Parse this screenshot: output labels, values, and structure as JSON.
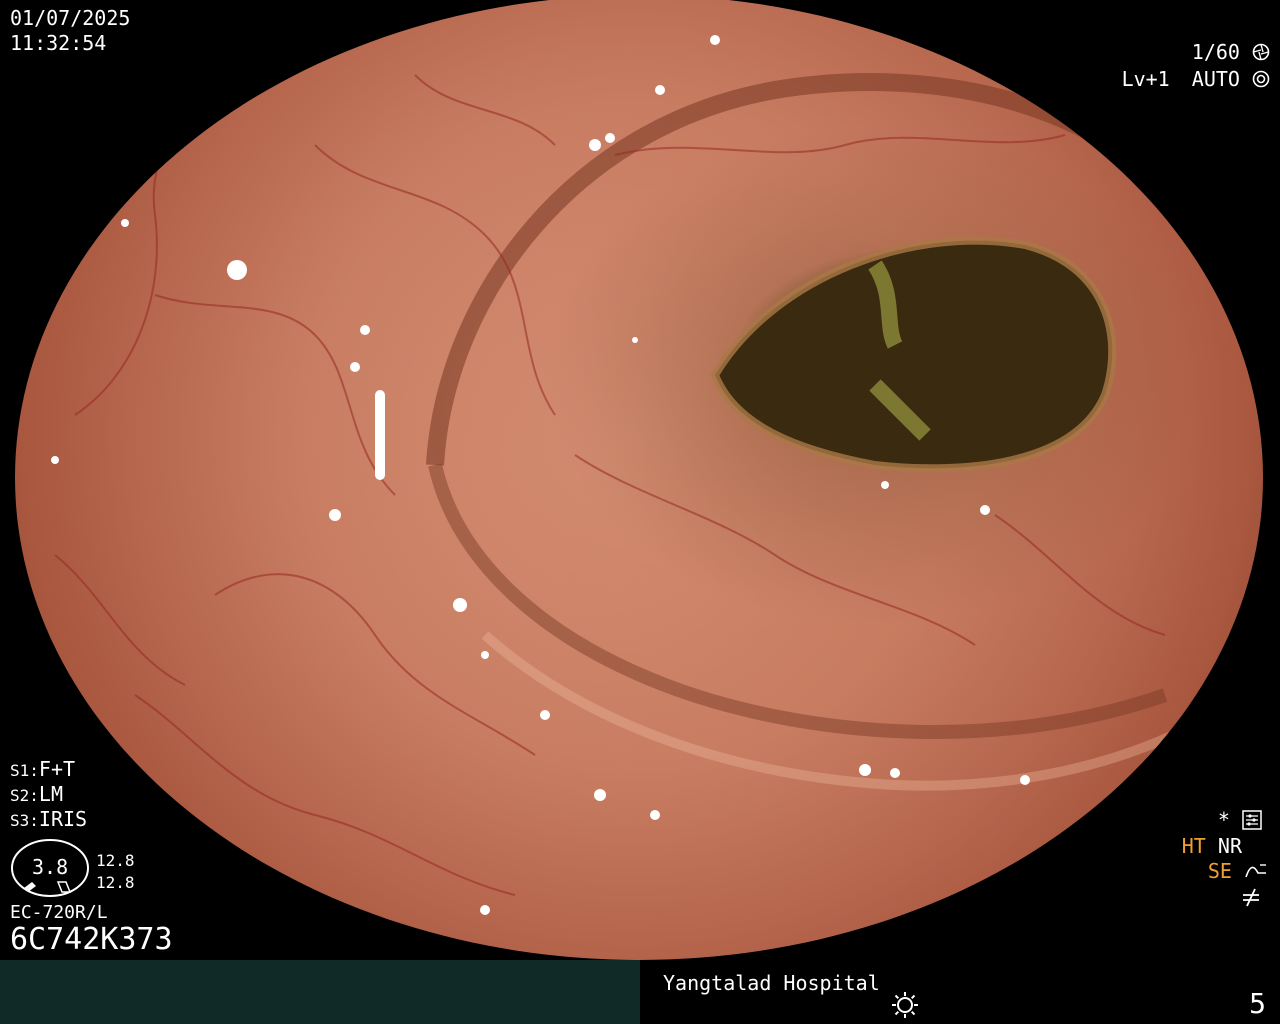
{
  "header": {
    "date": "01/07/2025",
    "time": "11:32:54"
  },
  "top_right": {
    "shutter": "1/60",
    "shutter_icon": "aperture-icon",
    "level": "Lv+1",
    "auto": "AUTO",
    "auto_icon": "iris-icon"
  },
  "settings": {
    "s1_label": "S1:",
    "s1_value": "F+T",
    "s2_label": "S2:",
    "s2_value": "LM",
    "s3_label": "S3:",
    "s3_value": "IRIS"
  },
  "gauge": {
    "center_value": "3.8",
    "top_value": "12.8",
    "bottom_value": "12.8"
  },
  "scope": {
    "model": "EC-720R/L",
    "serial": "6C742K373"
  },
  "right_status": {
    "star": "*",
    "ht": "HT",
    "nr": "NR",
    "se": "SE",
    "se_icon": "curve-icon",
    "bottom_icon": "not-equal-icon"
  },
  "footer": {
    "hospital": "Yangtalad Hospital",
    "brightness_icon": "brightness-icon",
    "number": "5"
  },
  "colors": {
    "orange": "#f0a030",
    "footer_left": "#102a28",
    "mucosa": "#c97e63",
    "lumen": "#3a2c10"
  }
}
